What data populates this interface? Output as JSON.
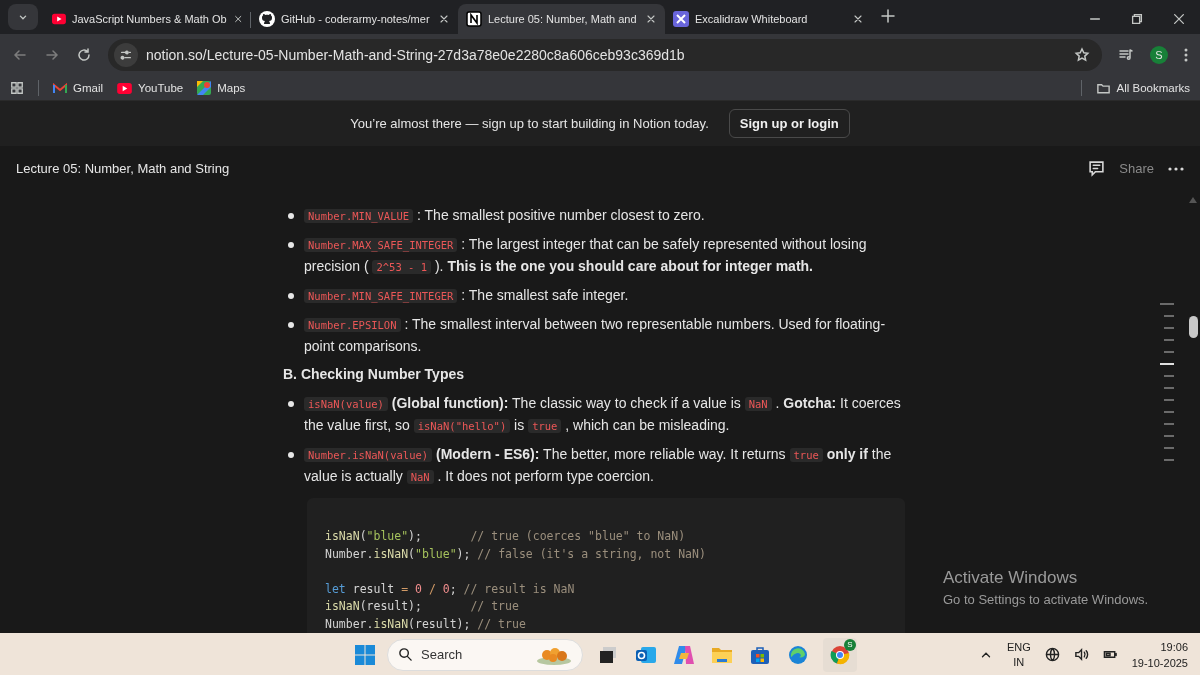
{
  "browser": {
    "tabs": [
      {
        "title": "JavaScript Numbers & Math Ob",
        "selected": false
      },
      {
        "title": "GitHub - coderarmy-notes/mer",
        "selected": false
      },
      {
        "title": "Lecture 05: Number, Math and",
        "selected": true
      },
      {
        "title": "Excalidraw Whiteboard",
        "selected": false
      }
    ],
    "address": "notion.so/Lecture-05-Number-Math-and-String-27d3a78e0e2280c8a606ceb93c369d1b",
    "profile": "S",
    "bookmarks": [
      "Gmail",
      "YouTube",
      "Maps"
    ],
    "all_bookmarks": "All Bookmarks"
  },
  "banner": {
    "text": "You’re almost there — sign up to start building in Notion today.",
    "button": "Sign up or login"
  },
  "page": {
    "title": "Lecture 05: Number, Math and String",
    "share": "Share"
  },
  "list_1": [
    [
      {
        "kind": "code",
        "text": "Number.MIN_VALUE"
      },
      {
        "kind": "text",
        "text": " : The smallest positive number closest to zero."
      }
    ],
    [
      {
        "kind": "code",
        "text": "Number.MAX_SAFE_INTEGER"
      },
      {
        "kind": "text",
        "text": " : The largest integer that can be safely represented without losing precision ( "
      },
      {
        "kind": "code",
        "text": "2^53 - 1"
      },
      {
        "kind": "text",
        "text": " ). **This is the one you should care about for integer math.**"
      }
    ],
    [
      {
        "kind": "code",
        "text": "Number.MIN_SAFE_INTEGER"
      },
      {
        "kind": "text",
        "text": " : The smallest safe integer."
      }
    ],
    [
      {
        "kind": "code",
        "text": "Number.EPSILON"
      },
      {
        "kind": "text",
        "text": " : The smallest interval between two representable numbers. Used for floating-point comparisons."
      }
    ]
  ],
  "heading": "B. Checking Number Types",
  "list_2": [
    [
      {
        "kind": "code",
        "text": "isNaN(value)"
      },
      {
        "kind": "text",
        "text": " **(Global function):** The classic way to check if a value is "
      },
      {
        "kind": "code",
        "text": "NaN"
      },
      {
        "kind": "text",
        "text": " . **Gotcha:** It coerces the value first, so "
      },
      {
        "kind": "code",
        "text": "isNaN(\"hello\")"
      },
      {
        "kind": "text",
        "text": " is "
      },
      {
        "kind": "code",
        "text": "true"
      },
      {
        "kind": "text",
        "text": " , which can be misleading."
      }
    ],
    [
      {
        "kind": "code",
        "text": "Number.isNaN(value)"
      },
      {
        "kind": "text",
        "text": " **(Modern - ES6):** The better, more reliable way. It returns "
      },
      {
        "kind": "code",
        "text": "true"
      },
      {
        "kind": "text",
        "text": " **only if** the value is actually "
      },
      {
        "kind": "code",
        "text": "NaN"
      },
      {
        "kind": "text",
        "text": " . It does not perform type coercion."
      }
    ]
  ],
  "code_block": {
    "lines": [
      {
        "kind": "code",
        "tokens": [
          {
            "kind": "fn",
            "text": "isNaN"
          },
          {
            "kind": "plain",
            "text": "("
          },
          {
            "kind": "str",
            "text": "\"blue\""
          },
          {
            "kind": "plain",
            "text": ");       "
          },
          {
            "kind": "comment",
            "text": "// true (coerces \"blue\" to NaN)"
          }
        ]
      },
      {
        "kind": "code",
        "tokens": [
          {
            "kind": "plain",
            "text": "Number."
          },
          {
            "kind": "fn",
            "text": "isNaN"
          },
          {
            "kind": "plain",
            "text": "("
          },
          {
            "kind": "str",
            "text": "\"blue\""
          },
          {
            "kind": "plain",
            "text": "); "
          },
          {
            "kind": "comment",
            "text": "// false (it's a string, not NaN)"
          }
        ]
      },
      {
        "kind": "blank"
      },
      {
        "kind": "code",
        "tokens": [
          {
            "kind": "kw",
            "text": "let"
          },
          {
            "kind": "plain",
            "text": " result "
          },
          {
            "kind": "op",
            "text": "= "
          },
          {
            "kind": "num",
            "text": "0"
          },
          {
            "kind": "op",
            "text": " / "
          },
          {
            "kind": "num",
            "text": "0"
          },
          {
            "kind": "plain",
            "text": "; "
          },
          {
            "kind": "comment",
            "text": "// result is NaN"
          }
        ]
      },
      {
        "kind": "code",
        "tokens": [
          {
            "kind": "fn",
            "text": "isNaN"
          },
          {
            "kind": "plain",
            "text": "(result);       "
          },
          {
            "kind": "comment",
            "text": "// true"
          }
        ]
      },
      {
        "kind": "code",
        "tokens": [
          {
            "kind": "plain",
            "text": "Number."
          },
          {
            "kind": "fn",
            "text": "isNaN"
          },
          {
            "kind": "plain",
            "text": "(result); "
          },
          {
            "kind": "comment",
            "text": "// true"
          }
        ]
      }
    ]
  },
  "activation": {
    "title": "Activate Windows",
    "subtitle": "Go to Settings to activate Windows."
  },
  "taskbar": {
    "search_placeholder": "Search",
    "chrome_badge": "S",
    "language": "ENG",
    "region": "IN",
    "time": "19:06",
    "date": "19-10-2025"
  }
}
